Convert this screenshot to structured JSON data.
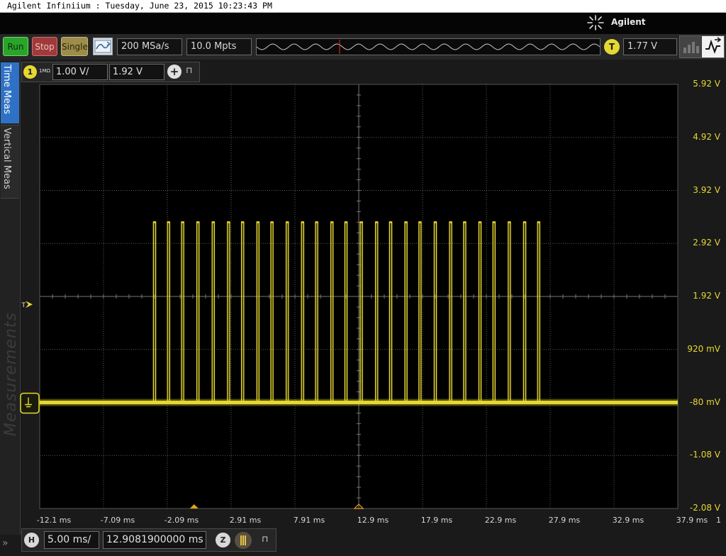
{
  "window": {
    "title": "Agilent Infiniium : Tuesday, June 23, 2015 10:23:43 PM"
  },
  "brand": {
    "name": "Agilent"
  },
  "toolbar": {
    "run_label": "Run",
    "stop_label": "Stop",
    "single_label": "Single",
    "sample_rate": "200 MSa/s",
    "memory_depth": "10.0 Mpts",
    "trigger_badge": "T",
    "trigger_level": "1.77 V"
  },
  "sidebar": {
    "tabs": [
      {
        "label": "Time Meas"
      },
      {
        "label": "Vertical Meas"
      }
    ],
    "panel_label": "Measurements",
    "expand_label": "»"
  },
  "channel": {
    "badge": "1",
    "impedance": "1MΩ",
    "scale": "1.00 V/",
    "offset": "1.92 V",
    "add_label": "+"
  },
  "horizontal": {
    "badge": "H",
    "scale": "5.00 ms/",
    "position": "12.9081900000 ms",
    "zoom_badge": "Z"
  },
  "chart_data": {
    "type": "line",
    "series": [
      {
        "name": "1",
        "baseline_V": -0.08,
        "high_V": 3.32,
        "pulse_times_ms": [
          -3.1,
          -2.0,
          -0.9,
          0.3,
          1.5,
          2.7,
          3.8,
          5.0,
          6.1,
          7.3,
          8.5,
          9.6,
          10.8,
          11.9,
          13.1,
          14.3,
          15.4,
          16.6,
          17.7,
          18.9,
          20.1,
          21.2,
          22.4,
          23.5,
          24.7,
          25.9,
          27.0
        ]
      }
    ],
    "x_ticks": [
      "-12.1 ms",
      "-7.09 ms",
      "-2.09 ms",
      "2.91 ms",
      "7.91 ms",
      "12.9 ms",
      "17.9 ms",
      "22.9 ms",
      "27.9 ms",
      "32.9 ms",
      "37.9 ms"
    ],
    "x_end_label": "1",
    "y_ticks": [
      "5.92 V",
      "4.92 V",
      "3.92 V",
      "2.92 V",
      "1.92 V",
      "920 mV",
      "-80 mV",
      "-1.08 V",
      "-2.08 V"
    ],
    "xlim_ms": [
      -12.1,
      37.9
    ],
    "ylim_V": [
      -2.08,
      5.92
    ],
    "trigger_marker": "T",
    "grid": true,
    "colors": {
      "trace": "#e6d832",
      "grid": "#5a5a5a",
      "background": "#000000"
    }
  }
}
